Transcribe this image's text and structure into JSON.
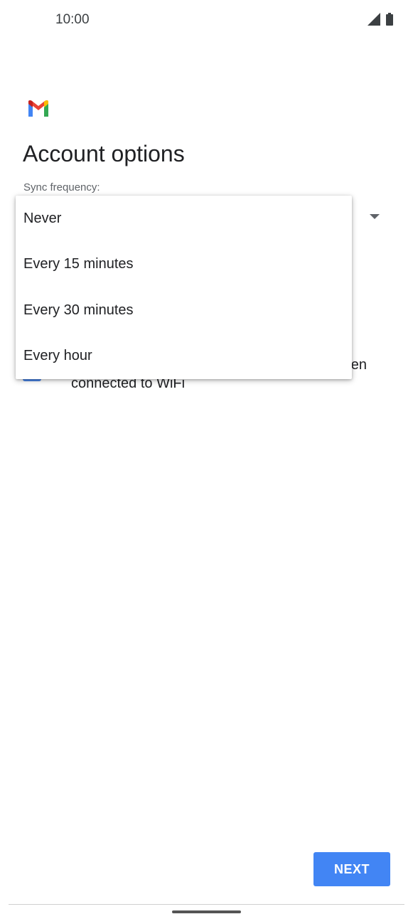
{
  "status_bar": {
    "time": "10:00",
    "icons": [
      "signal-icon",
      "battery-icon"
    ]
  },
  "app": {
    "logo_icon": "gmail-logo-icon"
  },
  "page": {
    "title": "Account options",
    "sync_label": "Sync frequency:"
  },
  "dropdown": {
    "options": [
      "Never",
      "Every 15 minutes",
      "Every 30 minutes",
      "Every hour"
    ]
  },
  "background_setting": {
    "partial_line1": "en",
    "line2": "connected to WiFi",
    "checked": true
  },
  "actions": {
    "next_label": "NEXT"
  },
  "colors": {
    "accent": "#4285f4",
    "checkbox": "#4a86e8"
  }
}
